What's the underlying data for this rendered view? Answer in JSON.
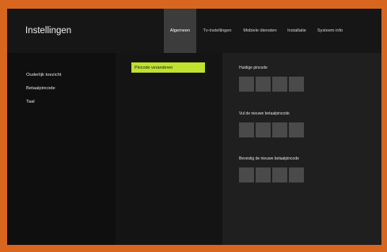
{
  "header": {
    "title": "Instellingen",
    "tabs": [
      {
        "label": "Algemeen",
        "active": true
      },
      {
        "label": "Tv-instellingen",
        "active": false
      },
      {
        "label": "Mobiele diensten",
        "active": false
      },
      {
        "label": "Installatie",
        "active": false
      },
      {
        "label": "Systeem info",
        "active": false
      }
    ]
  },
  "sidebar": {
    "items": [
      {
        "label": "Ouderlijk toezicht"
      },
      {
        "label": "Betaalpincode"
      },
      {
        "label": "Taal"
      }
    ]
  },
  "middle": {
    "button_label": "Pincode veranderen"
  },
  "form": {
    "current_pin_label": "Huidige pincode",
    "new_pin_label": "Vul de nieuwe betaalpincode",
    "confirm_pin_label": "Bevestig de nieuwe betaalpincode"
  },
  "colors": {
    "frame": "#d8661e",
    "accent": "#bfe12f",
    "active_tab": "#3c3c3c",
    "pin_box": "#4a4a4a"
  }
}
